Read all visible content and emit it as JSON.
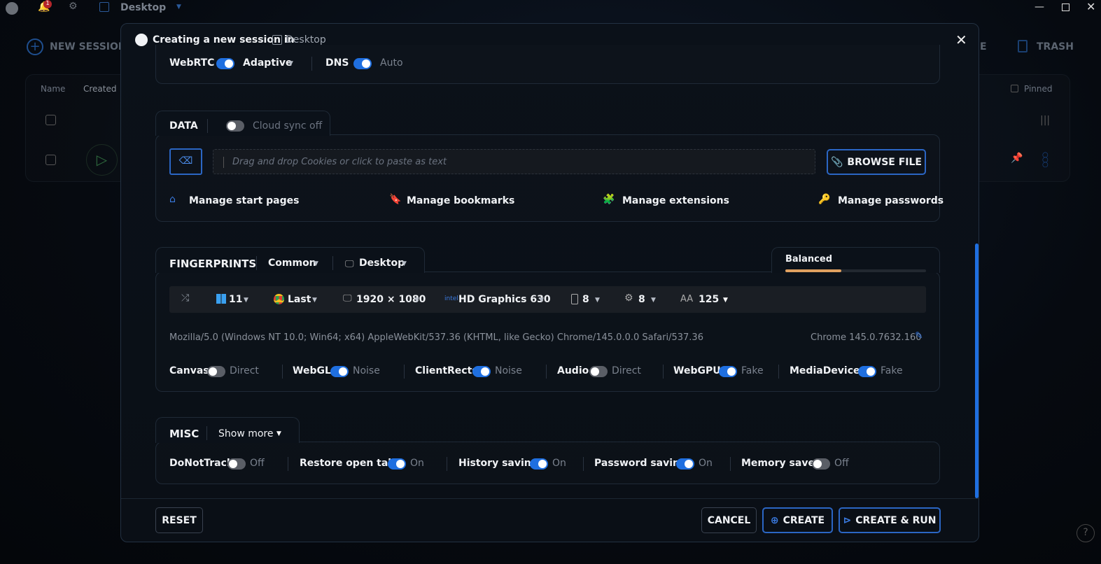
{
  "topbar": {
    "notification_count": "1",
    "workspace": "Desktop"
  },
  "background": {
    "new_session": "NEW SESSION",
    "trash": "TRASH",
    "partial_label": "E",
    "col_name": "Name",
    "col_created": "Created",
    "pinned": "Pinned"
  },
  "modal": {
    "title": "Creating a new session in",
    "workspace": "Desktop",
    "network": {
      "webrtc_label": "WebRTC",
      "webrtc_mode": "Adaptive",
      "dns_label": "DNS",
      "dns_value": "Auto"
    },
    "data": {
      "title": "DATA",
      "cloud_sync": "Cloud sync off",
      "cookies_placeholder": "Drag and drop Cookies or click to paste as text",
      "browse_file": "BROWSE FILE",
      "links": [
        "Manage start pages",
        "Manage bookmarks",
        "Manage extensions",
        "Manage passwords"
      ]
    },
    "fingerprints": {
      "title": "FINGERPRINTS",
      "preset": "Common",
      "device": "Desktop",
      "profile": "Balanced",
      "profile_level": 0.4,
      "os": "11",
      "browser": "Last",
      "resolution": "1920 × 1080",
      "gpu": "HD Graphics 630",
      "memory": "8",
      "cpu": "8",
      "fonts": "125",
      "user_agent": "Mozilla/5.0 (Windows NT 10.0; Win64; x64) AppleWebKit/537.36 (KHTML, like Gecko) Chrome/145.0.0.0 Safari/537.36",
      "chrome_version": "Chrome 145.0.7632.160",
      "toggles": [
        {
          "label": "Canvas",
          "value": "Direct",
          "on": false
        },
        {
          "label": "WebGL",
          "value": "Noise",
          "on": true
        },
        {
          "label": "ClientRects",
          "value": "Noise",
          "on": true
        },
        {
          "label": "Audio",
          "value": "Direct",
          "on": false
        },
        {
          "label": "WebGPU",
          "value": "Fake",
          "on": true
        },
        {
          "label": "MediaDevices",
          "value": "Fake",
          "on": true
        }
      ]
    },
    "misc": {
      "title": "MISC",
      "show_more": "Show more",
      "toggles": [
        {
          "label": "DoNotTrack",
          "value": "Off",
          "on": false
        },
        {
          "label": "Restore open tabs",
          "value": "On",
          "on": true
        },
        {
          "label": "History saving",
          "value": "On",
          "on": true
        },
        {
          "label": "Password saving",
          "value": "On",
          "on": true
        },
        {
          "label": "Memory saver",
          "value": "Off",
          "on": false
        }
      ]
    },
    "footer": {
      "reset": "RESET",
      "cancel": "CANCEL",
      "create": "CREATE",
      "create_run": "CREATE & RUN"
    }
  }
}
